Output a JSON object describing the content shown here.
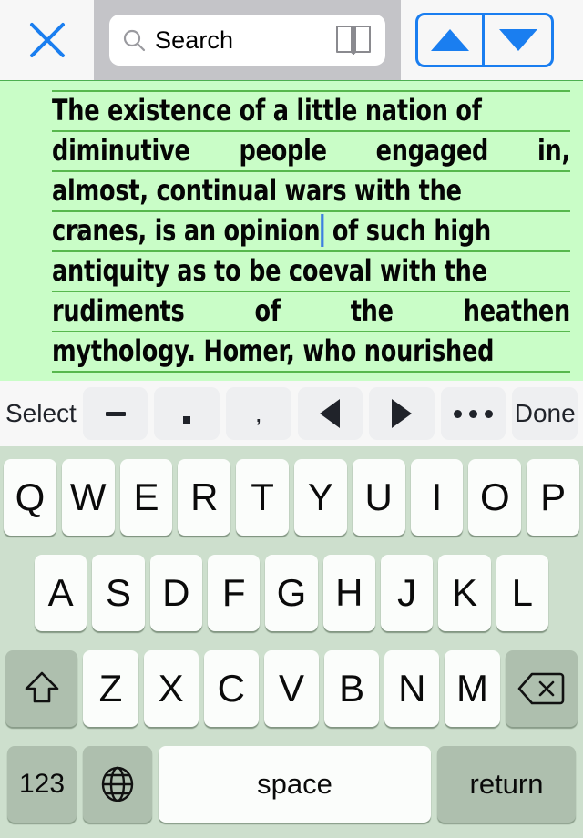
{
  "search_bar": {
    "close_icon": "close-x-icon",
    "search_icon": "search-magnifier-icon",
    "placeholder": "Search",
    "value": "",
    "dictionary_icon": "open-book-icon",
    "prev_label": "▲",
    "next_label": "▼",
    "accent_color": "#1a7ef0",
    "panel_color": "#c4c4c8"
  },
  "document": {
    "background_color": "#c9fdc7",
    "rule_color": "#57b84e",
    "caret_color": "#3f7fe0",
    "line_number": "5",
    "line_number_on_line": 4,
    "full_text": "The existence of a little nation of diminutive people engaged in, almost, continual wars with the cranes, is an opinion of such high antiquity as to be coeval with the rudiments of the heathen mythology. Homer, who nourished",
    "lines": [
      {
        "words": [
          "The",
          "existence",
          "of",
          "a",
          "little",
          "nation",
          "of"
        ],
        "justify": false,
        "caret_after_word": -1
      },
      {
        "words": [
          "diminutive",
          "people",
          "engaged",
          "in,"
        ],
        "justify": true,
        "caret_after_word": -1
      },
      {
        "words": [
          "almost,",
          "continual",
          "wars",
          "with",
          "the"
        ],
        "justify": false,
        "caret_after_word": -1
      },
      {
        "words": [
          "cranes,",
          "is",
          "an",
          "opinion",
          "of",
          "such",
          "high"
        ],
        "justify": false,
        "caret_after_word": 3
      },
      {
        "words": [
          "antiquity",
          "as",
          "to",
          "be",
          "coeval",
          "with",
          "the"
        ],
        "justify": false,
        "caret_after_word": -1
      },
      {
        "words": [
          "rudiments",
          "of",
          "the",
          "heathen"
        ],
        "justify": true,
        "caret_after_word": -1
      },
      {
        "words": [
          "mythology.",
          "Homer,",
          "who",
          "nourished"
        ],
        "justify": false,
        "caret_after_word": -1
      }
    ]
  },
  "accessory_toolbar": {
    "background_color": "#f7f7f7",
    "buttons": [
      {
        "name": "select-button",
        "label": "Select",
        "kind": "text",
        "plain": true
      },
      {
        "name": "hyphen-key",
        "label": "-",
        "kind": "dash",
        "plain": false
      },
      {
        "name": "period-key",
        "label": ".",
        "kind": "period",
        "plain": false
      },
      {
        "name": "comma-key",
        "label": ",",
        "kind": "text",
        "plain": false
      },
      {
        "name": "cursor-left-button",
        "label": "◀",
        "kind": "left",
        "plain": false
      },
      {
        "name": "cursor-right-button",
        "label": "▶",
        "kind": "right",
        "plain": false
      },
      {
        "name": "more-options-button",
        "label": "•••",
        "kind": "dots",
        "plain": false
      },
      {
        "name": "done-button",
        "label": "Done",
        "kind": "text",
        "plain": false
      }
    ]
  },
  "keyboard": {
    "background_color": "#cddfcd",
    "key_color": "#fbfdfb",
    "function_key_color": "#aebfae",
    "row1": [
      "Q",
      "W",
      "E",
      "R",
      "T",
      "Y",
      "U",
      "I",
      "O",
      "P"
    ],
    "row2": [
      "A",
      "S",
      "D",
      "F",
      "G",
      "H",
      "J",
      "K",
      "L"
    ],
    "row3_letters": [
      "Z",
      "X",
      "C",
      "V",
      "B",
      "N",
      "M"
    ],
    "shift_key": {
      "label": "",
      "icon": "shift-arrow-icon"
    },
    "backspace_key": {
      "label": "",
      "icon": "backspace-delete-icon"
    },
    "numbers_key": {
      "label": "123"
    },
    "globe_key": {
      "label": "",
      "icon": "globe-language-icon"
    },
    "space_key": {
      "label": "space"
    },
    "return_key": {
      "label": "return"
    }
  }
}
